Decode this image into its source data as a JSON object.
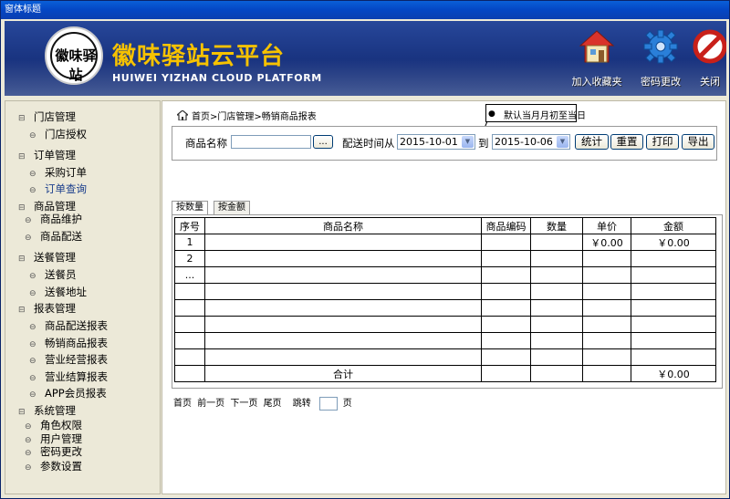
{
  "window": {
    "title": "窗体标题"
  },
  "header": {
    "brand_cn": "徽味驿站云平台",
    "brand_en": "HUIWEI YIZHAN CLOUD PLATFORM",
    "logo_text": "徽味驿站",
    "buttons": [
      {
        "label": "加入收藏夹",
        "icon": "house-icon"
      },
      {
        "label": "密码更改",
        "icon": "gear-icon"
      },
      {
        "label": "关闭",
        "icon": "close-icon"
      }
    ]
  },
  "sidebar": {
    "groups": [
      {
        "label": "门店管理",
        "items": [
          "门店授权"
        ]
      },
      {
        "label": "订单管理",
        "items": [
          "采购订单",
          "订单查询"
        ]
      },
      {
        "label": "商品管理",
        "items": [
          "商品维护",
          "商品配送"
        ]
      },
      {
        "label": "送餐管理",
        "items": [
          "送餐员",
          "送餐地址"
        ]
      },
      {
        "label": "报表管理",
        "items": [
          "商品配送报表",
          "畅销商品报表",
          "营业经营报表",
          "营业结算报表",
          "APP会员报表"
        ]
      },
      {
        "label": "系统管理",
        "items": [
          "角色权限",
          "用户管理",
          "密码更改",
          "参数设置"
        ]
      }
    ]
  },
  "breadcrumb": "首页>门店管理>畅销商品报表",
  "filter": {
    "product_label": "商品名称",
    "product_value": "",
    "browse_label": "...",
    "date_from_label": "配送时间从",
    "date_from": "2015-10-01",
    "date_to_label": "到",
    "date_to": "2015-10-06",
    "stats_button": "统计",
    "reset_button": "重置",
    "print_button": "打印",
    "export_button": "导出"
  },
  "note": "默认当月月初至当日",
  "tabs": [
    "按数量",
    "按金额"
  ],
  "table": {
    "headers": [
      "序号",
      "商品名称",
      "商品编码",
      "数量",
      "单价",
      "金额"
    ],
    "rows": [
      [
        "1",
        "",
        "",
        "",
        "￥0.00",
        "￥0.00"
      ],
      [
        "2",
        "",
        "",
        "",
        "",
        ""
      ],
      [
        "...",
        "",
        "",
        "",
        "",
        ""
      ],
      [
        "",
        "",
        "",
        "",
        "",
        ""
      ],
      [
        "",
        "",
        "",
        "",
        "",
        ""
      ],
      [
        "",
        "",
        "",
        "",
        "",
        ""
      ],
      [
        "",
        "",
        "",
        "",
        "",
        ""
      ],
      [
        "",
        "",
        "",
        "",
        "",
        ""
      ]
    ],
    "total_label": "合计",
    "total_amount": "￥0.00"
  },
  "pager": {
    "first": "首页",
    "prev": "前一页",
    "next": "下一页",
    "last": "尾页",
    "jump_label": "跳转",
    "jump_value": "",
    "page_suffix": "页"
  }
}
